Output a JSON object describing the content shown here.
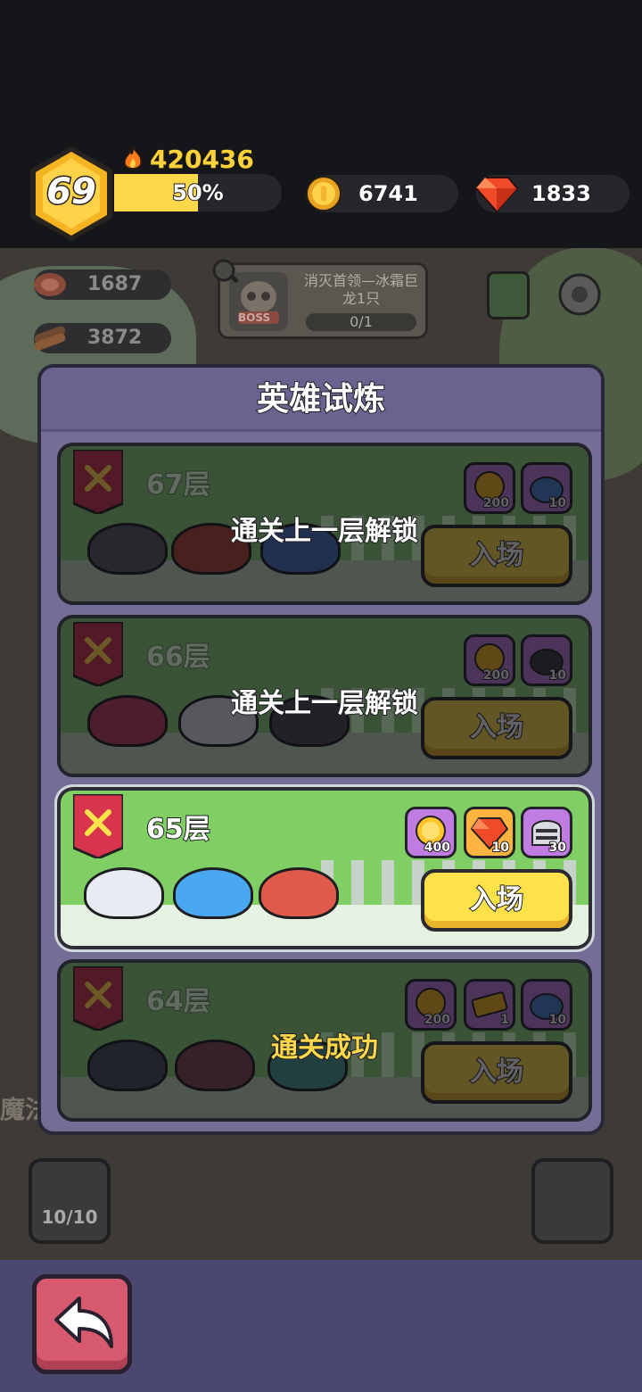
{
  "player": {
    "level": "69",
    "power": "420436",
    "xp_percent": "50%",
    "xp_fraction": 0.5
  },
  "currencies": {
    "gold": "6741",
    "gems": "1833"
  },
  "background": {
    "meat": "1687",
    "wood": "3872",
    "quest_title": "消灭首领—冰霜巨龙1只",
    "quest_progress": "0/1",
    "boss_badge": "BOSS",
    "side_label": "魔法",
    "team_count": "10/10"
  },
  "modal": {
    "title": "英雄试炼",
    "floors": [
      {
        "label": "67层",
        "status": "通关上一层解锁",
        "state": "locked",
        "rewards": [
          {
            "icon": "gold-coin-icon",
            "amount": "200",
            "color": "purple"
          },
          {
            "icon": "hero-shard-icon",
            "amount": "10",
            "color": "purple"
          }
        ],
        "button": "入场"
      },
      {
        "label": "66层",
        "status": "通关上一层解锁",
        "state": "locked",
        "rewards": [
          {
            "icon": "gold-coin-icon",
            "amount": "200",
            "color": "purple"
          },
          {
            "icon": "hero-shard-icon",
            "amount": "10",
            "color": "purple"
          }
        ],
        "button": "入场"
      },
      {
        "label": "65层",
        "status": "",
        "state": "active",
        "rewards": [
          {
            "icon": "gold-coin-icon",
            "amount": "400",
            "color": "purple"
          },
          {
            "icon": "gem-icon",
            "amount": "10",
            "color": "orange"
          },
          {
            "icon": "knight-helmet-icon",
            "amount": "30",
            "color": "purple"
          }
        ],
        "button": "入场"
      },
      {
        "label": "64层",
        "status": "通关成功",
        "state": "cleared",
        "rewards": [
          {
            "icon": "gold-coin-icon",
            "amount": "200",
            "color": "purple"
          },
          {
            "icon": "ticket-icon",
            "amount": "1",
            "color": "purple"
          },
          {
            "icon": "hero-shard-icon",
            "amount": "10",
            "color": "purple"
          }
        ],
        "button": "入场"
      }
    ]
  },
  "colors": {
    "gold": "#ffd84a",
    "modal_bg": "#746e96",
    "active_card": "#7fcf65",
    "back_button": "#d85a6e"
  }
}
